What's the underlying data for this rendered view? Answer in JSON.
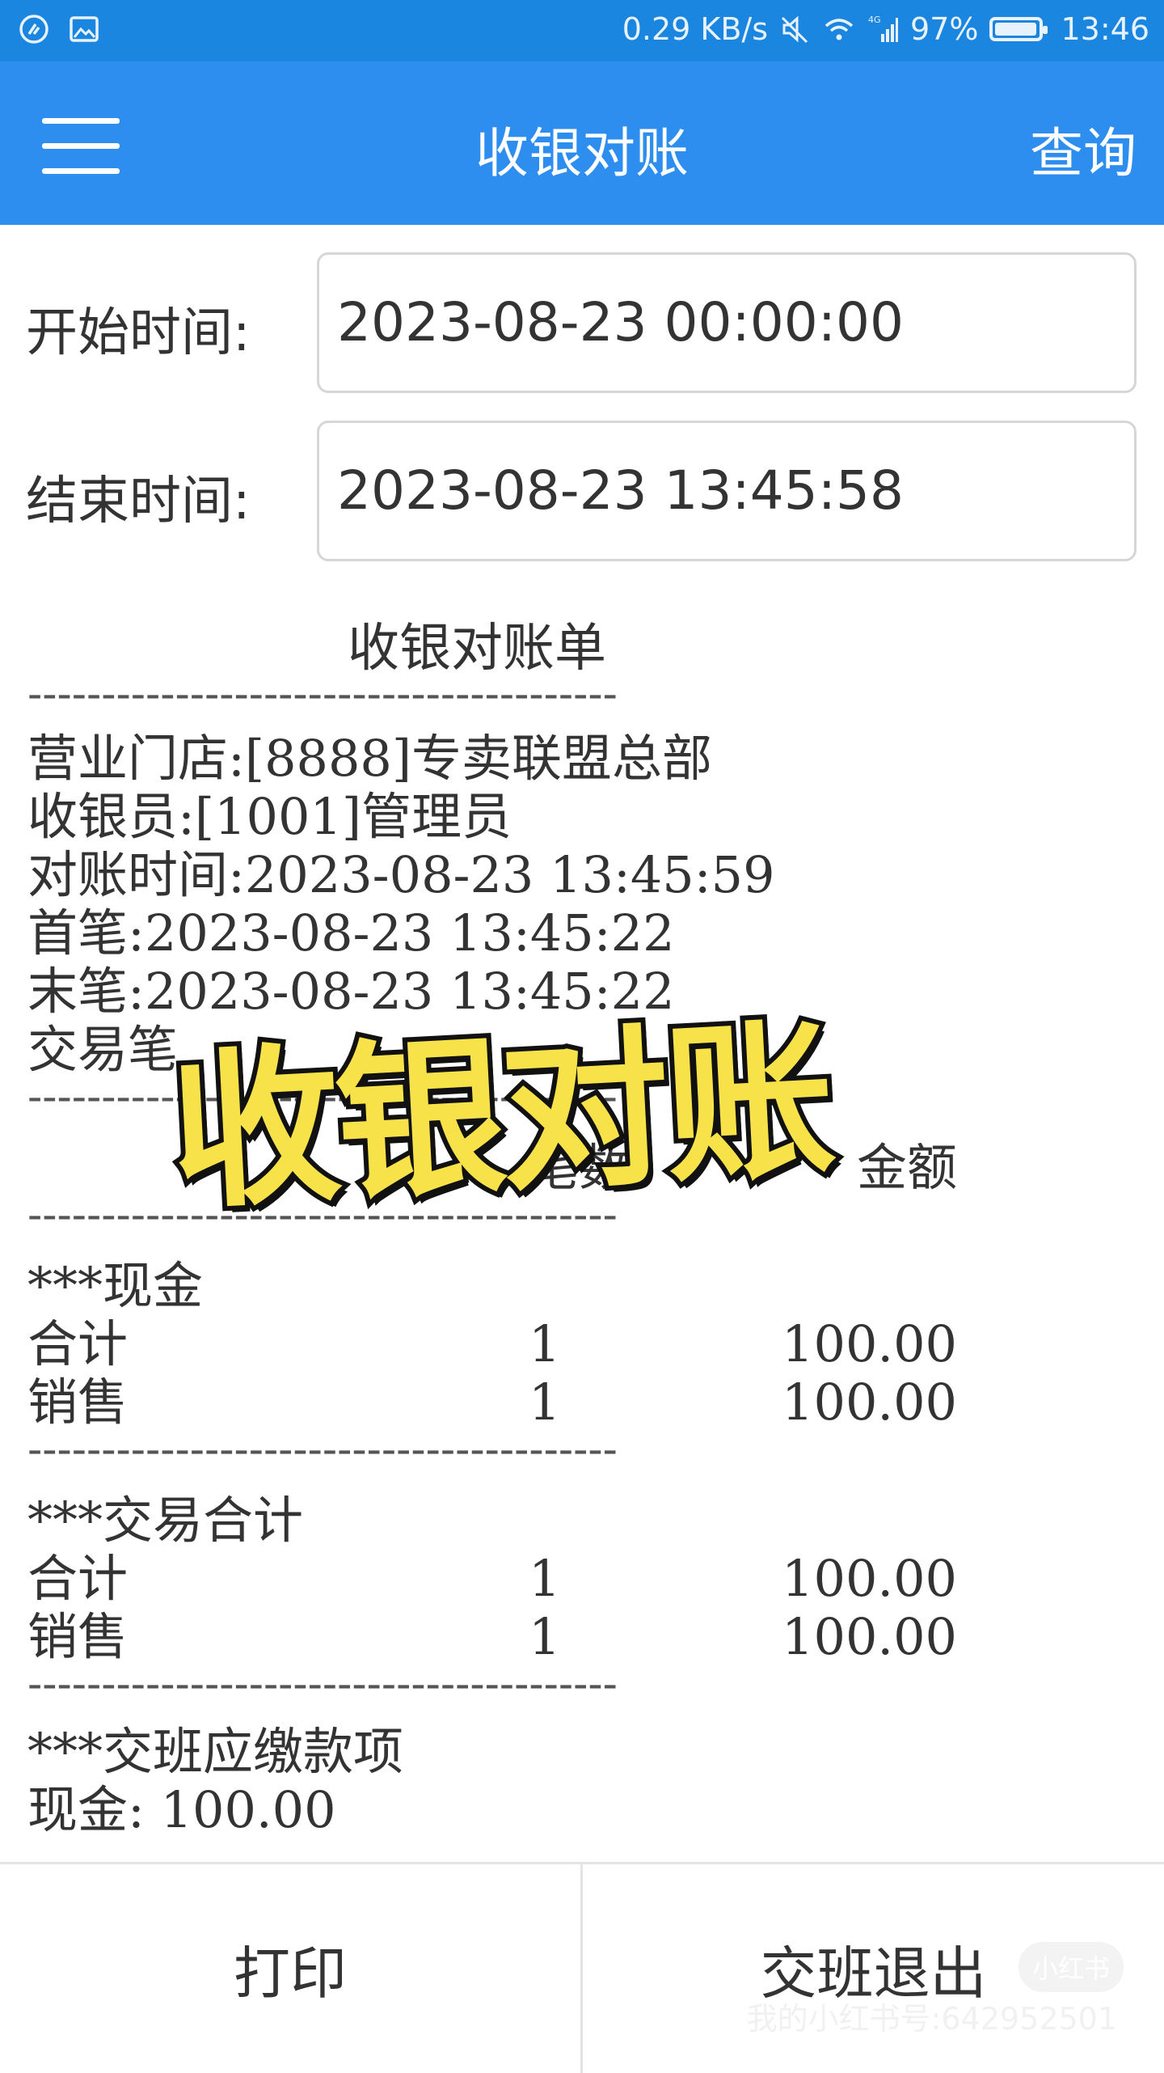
{
  "status_bar": {
    "speed": "0.29 KB/s",
    "network": "4G",
    "battery_percent": "97%",
    "battery_level": 0.97,
    "time": "13:46",
    "icons": [
      "app-notification-icon",
      "gallery-notification-icon",
      "mute-icon",
      "wifi-icon",
      "signal-icon",
      "battery-icon"
    ]
  },
  "app_bar": {
    "title": "收银对账",
    "query_label": "查询"
  },
  "fields": {
    "start_label": "开始时间:",
    "start_value": "2023-08-23 00:00:00",
    "end_label": "结束时间:",
    "end_value": "2023-08-23 13:45:58"
  },
  "receipt": {
    "title": "收银对账单",
    "divider": "----------------------------------------",
    "store": "营业门店:[8888]专卖联盟总部",
    "cashier": "收银员:[1001]管理员",
    "check_time": "对账时间:2023-08-23 13:45:59",
    "first": "首笔:2023-08-23 13:45:22",
    "last": "末笔:2023-08-23 13:45:22",
    "txn_count_label": "交易笔",
    "header_count": "笔数",
    "header_amount": "金额",
    "sections": [
      {
        "name": "***现金",
        "rows": [
          {
            "label": "合计",
            "count": "1",
            "amount": "100.00"
          },
          {
            "label": "销售",
            "count": "1",
            "amount": "100.00"
          }
        ]
      },
      {
        "name": "***交易合计",
        "rows": [
          {
            "label": "合计",
            "count": "1",
            "amount": "100.00"
          },
          {
            "label": "销售",
            "count": "1",
            "amount": "100.00"
          }
        ]
      }
    ],
    "handover_title": "***交班应缴款项",
    "handover_cash": "现金: 100.00"
  },
  "overlay_caption": "收银对账",
  "bottom": {
    "print_label": "打印",
    "exit_label": "交班退出",
    "watermark_badge": "小红书",
    "watermark_text": "我的小红书号:642952501"
  },
  "colors": {
    "status_bar": "#1a86e0",
    "app_bar": "#2d8ef0",
    "caption_fill": "#f7e24a"
  }
}
